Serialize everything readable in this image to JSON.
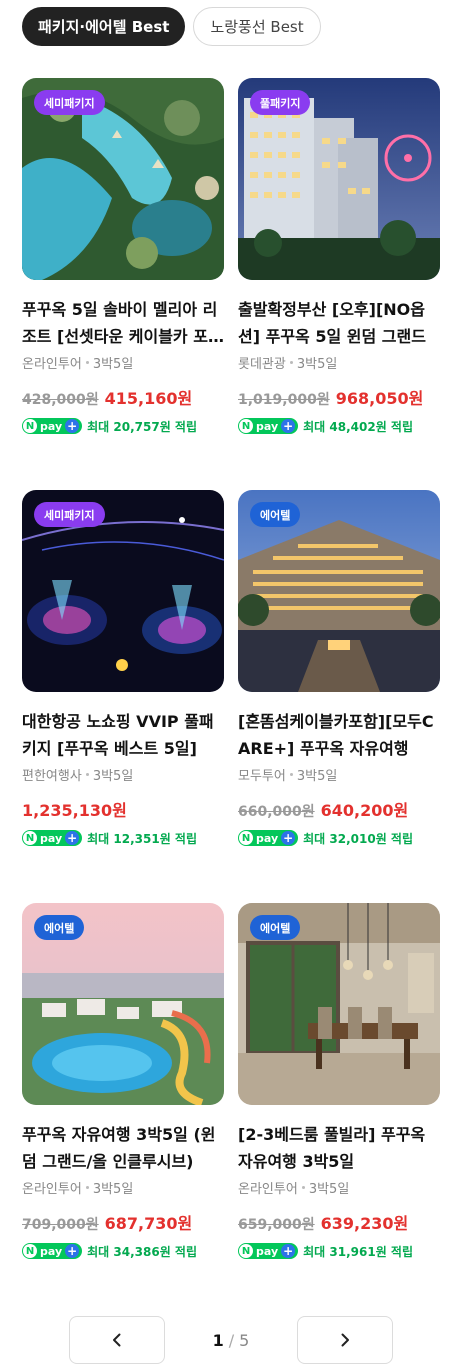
{
  "tabs": [
    {
      "label": "패키지·에어텔 Best",
      "active": true
    },
    {
      "label": "노랑풍선 Best",
      "active": false
    }
  ],
  "products": [
    {
      "badge": "세미패키지",
      "badge_color": "#8a3cf0",
      "title": "푸꾸옥 5일 솔바이 멜리아 리조트 [선셋타운 케이블카 포함]",
      "agency": "온라인투어",
      "duration": "3박5일",
      "original_price": "428,000원",
      "sale_price": "415,160원",
      "reward": "최대 20,757원 적립"
    },
    {
      "badge": "풀패키지",
      "badge_color": "#8a3cf0",
      "title": "출발확정부산 [오후][NO옵션] 푸꾸옥 5일 윈덤 그랜드",
      "agency": "롯데관광",
      "duration": "3박5일",
      "original_price": "1,019,000원",
      "sale_price": "968,050원",
      "reward": "최대 48,402원 적립"
    },
    {
      "badge": "세미패키지",
      "badge_color": "#8a3cf0",
      "title": "대한항공 노쇼핑 VVIP 풀패키지 [푸꾸옥 베스트 5일]",
      "agency": "편한여행사",
      "duration": "3박5일",
      "original_price": "",
      "sale_price": "1,235,130원",
      "reward": "최대 12,351원 적립"
    },
    {
      "badge": "에어텔",
      "badge_color": "#1f63d6",
      "title": "[혼똠섬케이블카포함][모두CARE+] 푸꾸옥 자유여행",
      "agency": "모두투어",
      "duration": "3박5일",
      "original_price": "660,000원",
      "sale_price": "640,200원",
      "reward": "최대 32,010원 적립"
    },
    {
      "badge": "에어텔",
      "badge_color": "#1f63d6",
      "title": "푸꾸옥 자유여행 3박5일 (윈덤 그랜드/올 인클루시브)",
      "agency": "온라인투어",
      "duration": "3박5일",
      "original_price": "709,000원",
      "sale_price": "687,730원",
      "reward": "최대 34,386원 적립"
    },
    {
      "badge": "에어텔",
      "badge_color": "#1f63d6",
      "title": "[2-3베드룸 풀빌라] 푸꾸옥 자유여행 3박5일",
      "agency": "온라인투어",
      "duration": "3박5일",
      "original_price": "659,000원",
      "sale_price": "639,230원",
      "reward": "최대 31,961원 적립"
    }
  ],
  "npay": {
    "n": "N",
    "pay": "pay",
    "plus": "+"
  },
  "pagination": {
    "current": "1",
    "separator": "/",
    "total": "5"
  }
}
